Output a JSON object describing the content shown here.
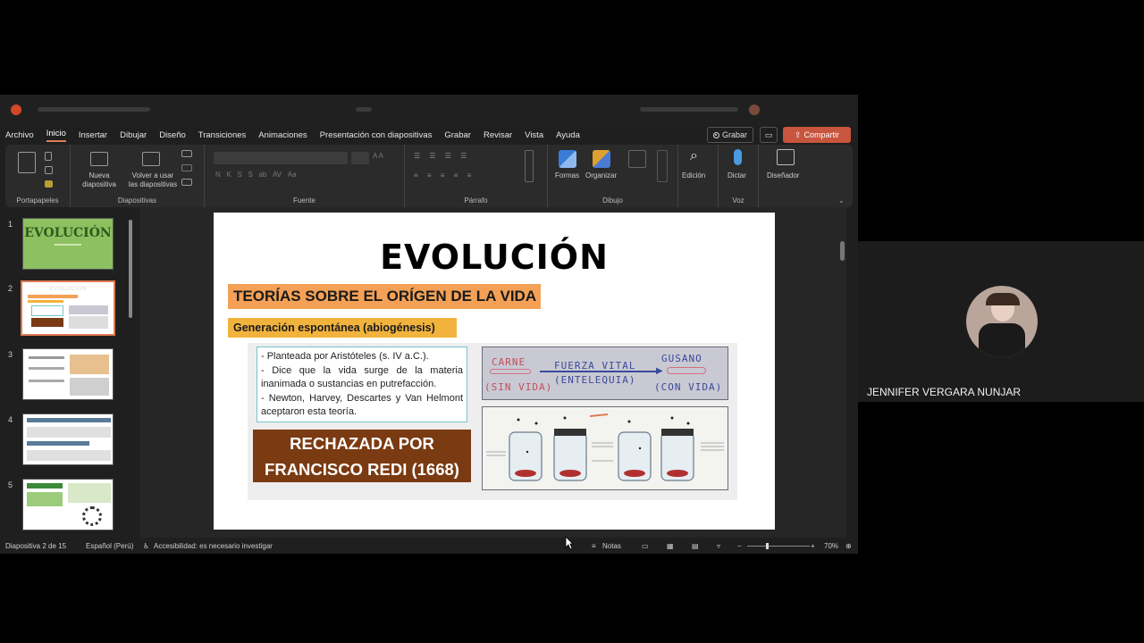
{
  "menu": [
    "Archivo",
    "Inicio",
    "Insertar",
    "Dibujar",
    "Diseño",
    "Transiciones",
    "Animaciones",
    "Presentación con diapositivas",
    "Grabar",
    "Revisar",
    "Vista",
    "Ayuda"
  ],
  "menu_active": "Inicio",
  "header_buttons": {
    "record": "Grabar",
    "share": "Compartir"
  },
  "ribbon": {
    "groups": {
      "clipboard": "Portapapeles",
      "slides": "Diapositivas",
      "font": "Fuente",
      "paragraph": "Párrafo",
      "drawing": "Dibujo",
      "voice": "Voz"
    },
    "new_slide": [
      "Nueva",
      "diapositiva"
    ],
    "reuse_slides": [
      "Volver a usar",
      "las diapositivas"
    ],
    "shapes": "Formas",
    "arrange": "Organizar",
    "editing": "Edición",
    "dictate": "Dictar",
    "designer": "Diseñador"
  },
  "thumbnails": [
    {
      "num": "1",
      "title": "EVOLUCIÓN"
    },
    {
      "num": "2",
      "title": "EVOLUCIÓN"
    },
    {
      "num": "3"
    },
    {
      "num": "4"
    },
    {
      "num": "5"
    }
  ],
  "slide": {
    "title": "EVOLUCIÓN",
    "subtitle": "TEORÍAS SOBRE EL ORÍGEN DE LA VIDA",
    "section": "Generación espontánea (abiogénesis)",
    "bullets": [
      "- Planteada por Aristóteles (s. IV a.C.).",
      "- Dice que la vida surge de la materia inanimada o sustancias en putrefacción.",
      "- Newton, Harvey, Descartes y Van Helmont aceptaron esta teoría."
    ],
    "rejected": [
      "RECHAZADA POR",
      "FRANCISCO REDI (1668)"
    ],
    "diagram": {
      "left_top": "CARNE",
      "left_bottom": "(SIN VIDA)",
      "middle_top": "FUERZA VITAL",
      "middle_bottom": "(ENTELEQUIA)",
      "right_top": "GUSANO",
      "right_bottom": "(CON VIDA)"
    }
  },
  "status": {
    "slide_count": "Diapositiva 2 de 15",
    "language": "Español (Perú)",
    "accessibility": "Accesibilidad: es necesario investigar",
    "notes": "Notas",
    "zoom": "70%"
  },
  "participant": {
    "name": "JENNIFER VERGARA NUNJAR"
  },
  "colors": {
    "accent": "#e07b53",
    "share": "#c8553d",
    "orange_band": "#f4a157",
    "yellow_band": "#f2b33d",
    "rejected_bg": "#7a3a12"
  }
}
